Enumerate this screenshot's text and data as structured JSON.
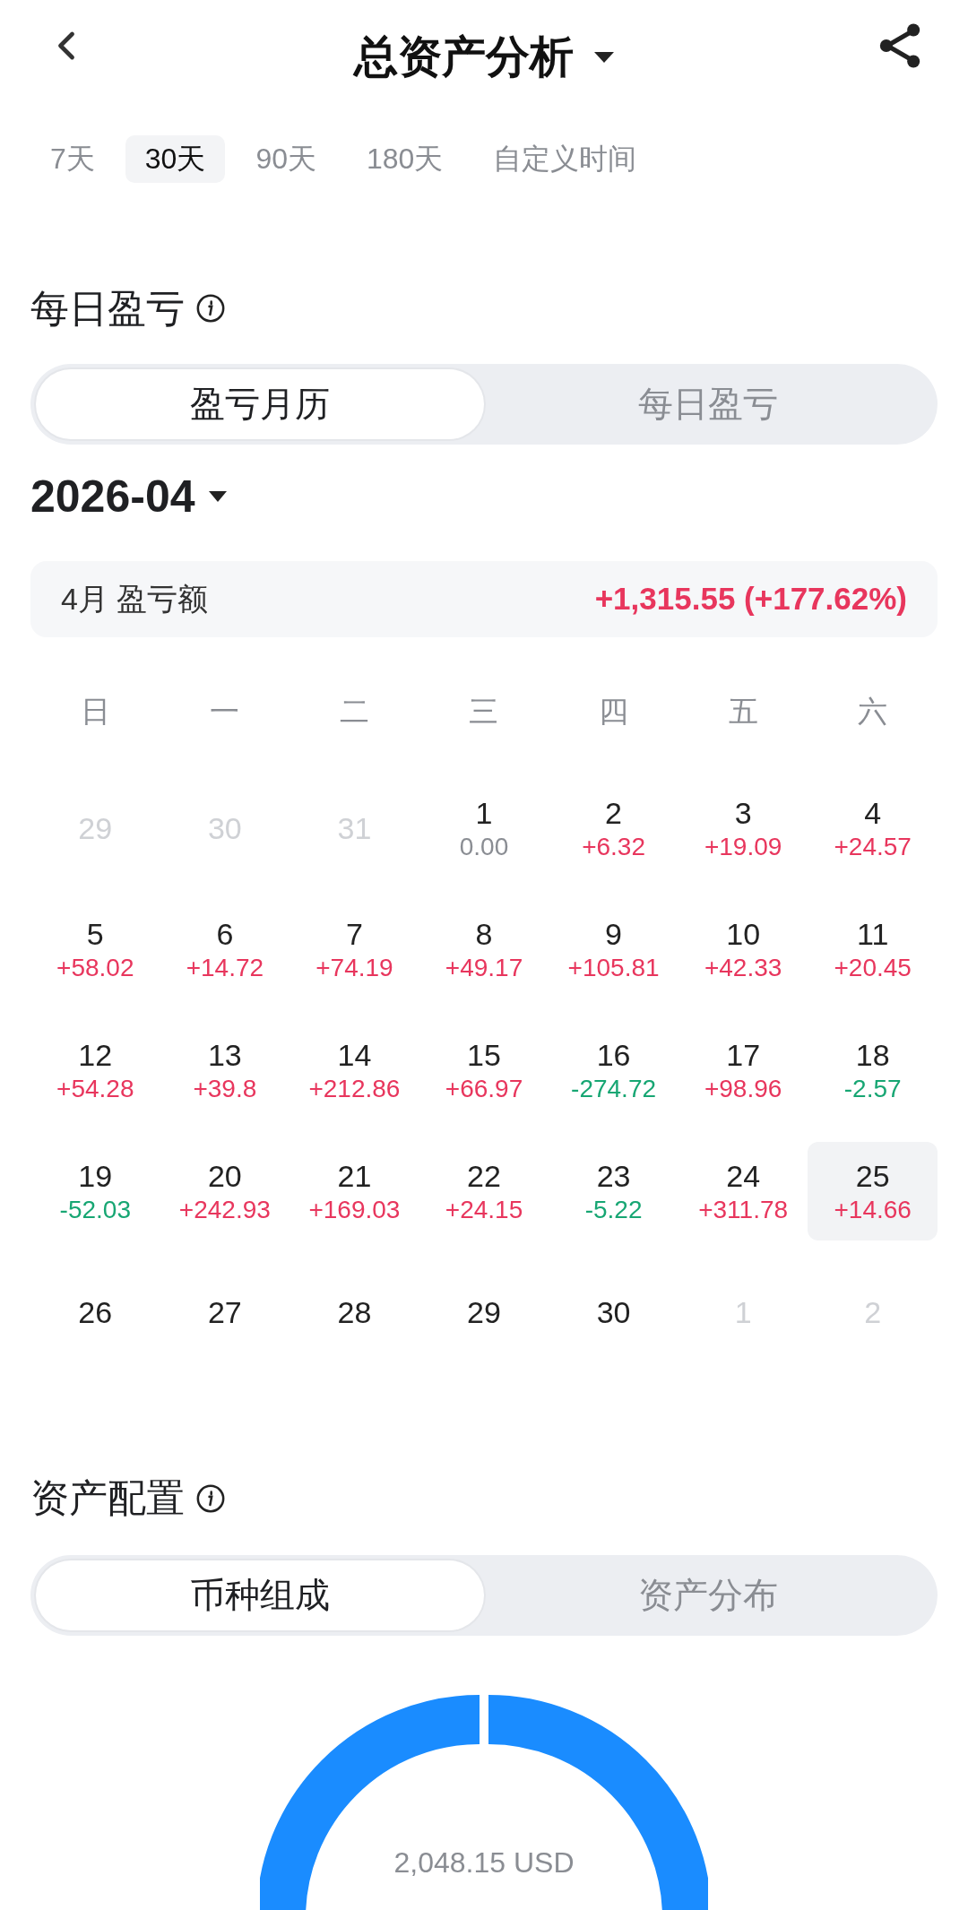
{
  "header": {
    "title": "总资产分析"
  },
  "ranges": [
    {
      "label": "7天",
      "selected": false
    },
    {
      "label": "30天",
      "selected": true
    },
    {
      "label": "90天",
      "selected": false
    },
    {
      "label": "180天",
      "selected": false
    },
    {
      "label": "自定义时间",
      "selected": false
    }
  ],
  "daily_pnl": {
    "title": "每日盈亏",
    "views": [
      {
        "label": "盈亏月历",
        "selected": true
      },
      {
        "label": "每日盈亏",
        "selected": false
      }
    ],
    "month": "2026-04",
    "summary": {
      "label": "4月 盈亏额",
      "value": "+1,315.55 (+177.62%)"
    },
    "weekdays": [
      "日",
      "一",
      "二",
      "三",
      "四",
      "五",
      "六"
    ],
    "days": [
      {
        "day": "29",
        "outside_month": true,
        "selected": false
      },
      {
        "day": "30",
        "outside_month": true,
        "selected": false
      },
      {
        "day": "31",
        "outside_month": true,
        "selected": false
      },
      {
        "day": "1",
        "outside_month": false,
        "selected": false,
        "pnl": "0.00",
        "color": "#8a8d93"
      },
      {
        "day": "2",
        "outside_month": false,
        "selected": false,
        "pnl": "+6.32",
        "color": "#e8365d"
      },
      {
        "day": "3",
        "outside_month": false,
        "selected": false,
        "pnl": "+19.09",
        "color": "#e8365d"
      },
      {
        "day": "4",
        "outside_month": false,
        "selected": false,
        "pnl": "+24.57",
        "color": "#e8365d"
      },
      {
        "day": "5",
        "outside_month": false,
        "selected": false,
        "pnl": "+58.02",
        "color": "#e8365d"
      },
      {
        "day": "6",
        "outside_month": false,
        "selected": false,
        "pnl": "+14.72",
        "color": "#e8365d"
      },
      {
        "day": "7",
        "outside_month": false,
        "selected": false,
        "pnl": "+74.19",
        "color": "#e8365d"
      },
      {
        "day": "8",
        "outside_month": false,
        "selected": false,
        "pnl": "+49.17",
        "color": "#e8365d"
      },
      {
        "day": "9",
        "outside_month": false,
        "selected": false,
        "pnl": "+105.81",
        "color": "#e8365d"
      },
      {
        "day": "10",
        "outside_month": false,
        "selected": false,
        "pnl": "+42.33",
        "color": "#e8365d"
      },
      {
        "day": "11",
        "outside_month": false,
        "selected": false,
        "pnl": "+20.45",
        "color": "#e8365d"
      },
      {
        "day": "12",
        "outside_month": false,
        "selected": false,
        "pnl": "+54.28",
        "color": "#e8365d"
      },
      {
        "day": "13",
        "outside_month": false,
        "selected": false,
        "pnl": "+39.8",
        "color": "#e8365d"
      },
      {
        "day": "14",
        "outside_month": false,
        "selected": false,
        "pnl": "+212.86",
        "color": "#e8365d"
      },
      {
        "day": "15",
        "outside_month": false,
        "selected": false,
        "pnl": "+66.97",
        "color": "#e8365d"
      },
      {
        "day": "16",
        "outside_month": false,
        "selected": false,
        "pnl": "-274.72",
        "color": "#17a673"
      },
      {
        "day": "17",
        "outside_month": false,
        "selected": false,
        "pnl": "+98.96",
        "color": "#e8365d"
      },
      {
        "day": "18",
        "outside_month": false,
        "selected": false,
        "pnl": "-2.57",
        "color": "#17a673"
      },
      {
        "day": "19",
        "outside_month": false,
        "selected": false,
        "pnl": "-52.03",
        "color": "#17a673"
      },
      {
        "day": "20",
        "outside_month": false,
        "selected": false,
        "pnl": "+242.93",
        "color": "#e8365d"
      },
      {
        "day": "21",
        "outside_month": false,
        "selected": false,
        "pnl": "+169.03",
        "color": "#e8365d"
      },
      {
        "day": "22",
        "outside_month": false,
        "selected": false,
        "pnl": "+24.15",
        "color": "#e8365d"
      },
      {
        "day": "23",
        "outside_month": false,
        "selected": false,
        "pnl": "-5.22",
        "color": "#17a673"
      },
      {
        "day": "24",
        "outside_month": false,
        "selected": false,
        "pnl": "+311.78",
        "color": "#e8365d"
      },
      {
        "day": "25",
        "outside_month": false,
        "selected": true,
        "pnl": "+14.66",
        "color": "#e8365d"
      },
      {
        "day": "26",
        "outside_month": false,
        "selected": false
      },
      {
        "day": "27",
        "outside_month": false,
        "selected": false
      },
      {
        "day": "28",
        "outside_month": false,
        "selected": false
      },
      {
        "day": "29",
        "outside_month": false,
        "selected": false
      },
      {
        "day": "30",
        "outside_month": false,
        "selected": false
      },
      {
        "day": "1",
        "outside_month": true,
        "selected": false
      },
      {
        "day": "2",
        "outside_month": true,
        "selected": false
      }
    ]
  },
  "allocation": {
    "title": "资产配置",
    "views": [
      {
        "label": "币种组成",
        "selected": true
      },
      {
        "label": "资产分布",
        "selected": false
      }
    ],
    "total": "2,048.15 USD"
  }
}
